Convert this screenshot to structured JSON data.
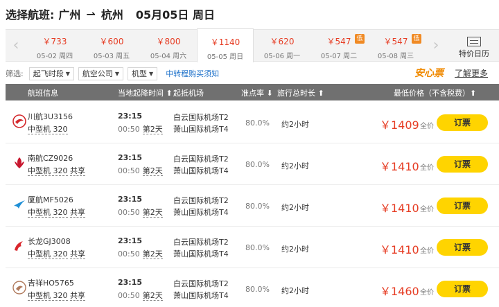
{
  "header": {
    "prefix": "选择航班:",
    "from": "广州",
    "arrow": "⇀",
    "to": "杭州",
    "date": "05月05日 周日"
  },
  "date_strip": {
    "days": [
      {
        "price": "￥733",
        "date": "05-02 周四"
      },
      {
        "price": "￥600",
        "date": "05-03 周五"
      },
      {
        "price": "￥800",
        "date": "05-04 周六"
      },
      {
        "price": "￥1140",
        "date": "05-05 周日",
        "active": true
      },
      {
        "price": "￥620",
        "date": "05-06 周一"
      },
      {
        "price": "￥547",
        "date": "05-07 周二",
        "badge": "低"
      },
      {
        "price": "￥547",
        "date": "05-08 周三",
        "badge": "低"
      }
    ],
    "special_label": "特价日历"
  },
  "filter": {
    "label": "筛选:",
    "buttons": [
      "起飞时段",
      "航空公司",
      "机型"
    ],
    "transfer_link": "中转程购买须知",
    "anxin": "安心票",
    "learn_more": "了解更多"
  },
  "columns": {
    "flight_info": "航班信息",
    "local_time": "当地起降时间 ⬆",
    "airport": "起抵机场",
    "on_time": "准点率 ⬇",
    "duration": "旅行总时长 ⬆",
    "price": "最低价格（不含税费）⬆"
  },
  "flights": [
    {
      "airline": "川航3U3156",
      "plane": "中型机 320",
      "shared": "",
      "dep": "23:15",
      "arr": "00:50",
      "day2": "第2天",
      "ap_from": "白云国际机场T2",
      "ap_to": "萧山国际机场T4",
      "rate": "80.0%",
      "duration": "约2小时",
      "price": "￥1409",
      "price_note": "全价",
      "book": "订票",
      "logo_color": "#d4282c"
    },
    {
      "airline": "南航CZ9026",
      "plane": "中型机 320",
      "shared": "共享",
      "dep": "23:15",
      "arr": "00:50",
      "day2": "第2天",
      "ap_from": "白云国际机场T2",
      "ap_to": "萧山国际机场T4",
      "rate": "80.0%",
      "duration": "约2小时",
      "price": "￥1410",
      "price_note": "全价",
      "book": "订票",
      "logo_color": "#c8172f"
    },
    {
      "airline": "厦航MF5026",
      "plane": "中型机 320",
      "shared": "共享",
      "dep": "23:15",
      "arr": "00:50",
      "day2": "第2天",
      "ap_from": "白云国际机场T2",
      "ap_to": "萧山国际机场T4",
      "rate": "80.0%",
      "duration": "约2小时",
      "price": "￥1410",
      "price_note": "全价",
      "book": "订票",
      "logo_color": "#1e8fd6"
    },
    {
      "airline": "长龙GJ3008",
      "plane": "中型机 320",
      "shared": "共享",
      "dep": "23:15",
      "arr": "00:50",
      "day2": "第2天",
      "ap_from": "白云国际机场T2",
      "ap_to": "萧山国际机场T4",
      "rate": "80.0%",
      "duration": "约2小时",
      "price": "￥1410",
      "price_note": "全价",
      "book": "订票",
      "logo_color": "#d9262c"
    },
    {
      "airline": "吉祥HO5765",
      "plane": "中型机 320",
      "shared": "共享",
      "dep": "23:15",
      "arr": "00:50",
      "day2": "第2天",
      "ap_from": "白云国际机场T2",
      "ap_to": "萧山国际机场T4",
      "rate": "80.0%",
      "duration": "约2小时",
      "price": "￥1460",
      "price_note": "全价",
      "book": "订票",
      "logo_color": "#b07a5c"
    }
  ]
}
